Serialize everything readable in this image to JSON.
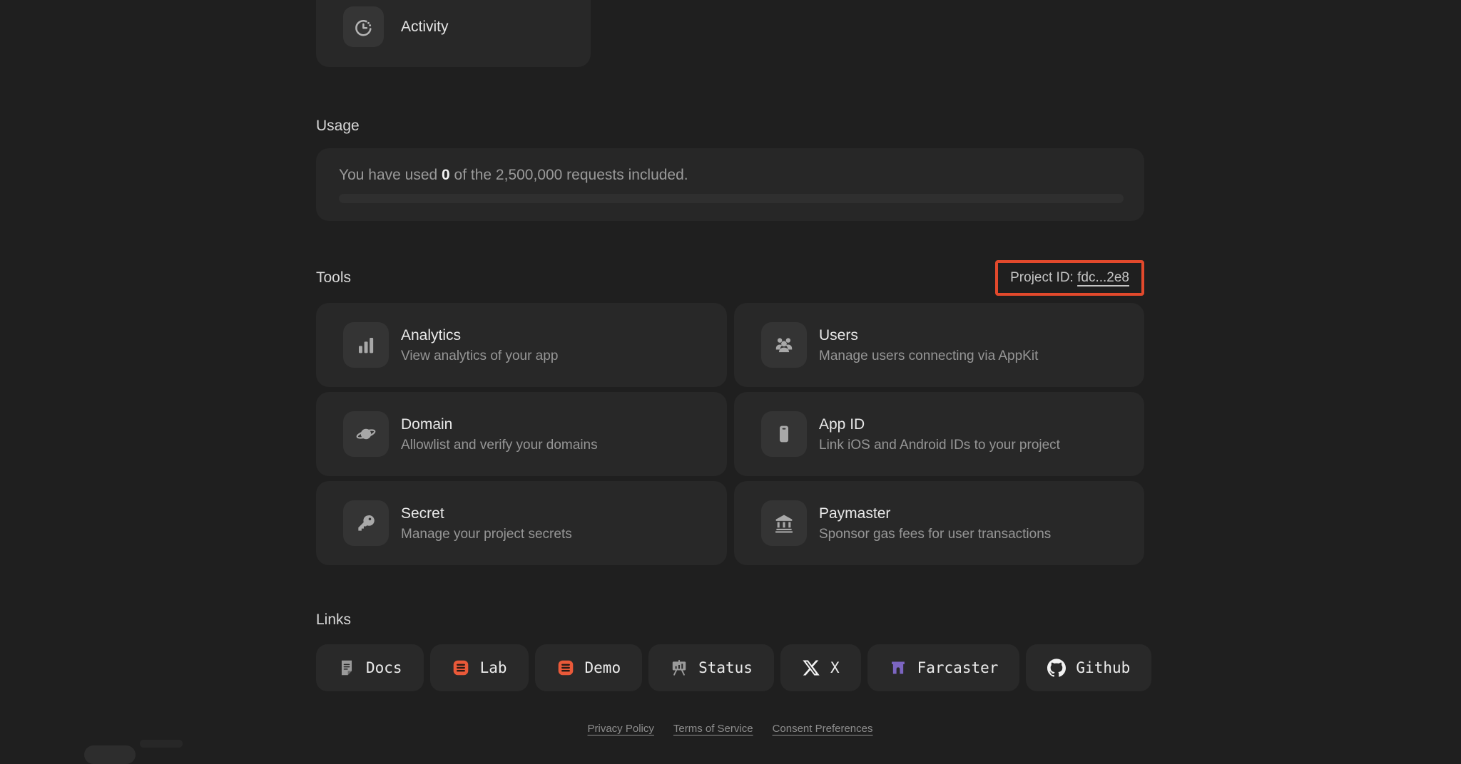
{
  "colors": {
    "page_bg": "#1F1F1F",
    "card_bg": "#282828",
    "tile_bg": "#343434",
    "button_bg": "#292929",
    "annotation_red": "#E2492C",
    "accent_orange": "#EA5939",
    "farcaster_purple": "#7C65C1"
  },
  "activity_card": {
    "label": "Activity",
    "icon": "clock-activity-icon"
  },
  "usage": {
    "heading": "Usage",
    "text_prefix": "You have used ",
    "used_value": "0",
    "text_suffix": " of the 2,500,000 requests included.",
    "progress_percent": 0
  },
  "tools": {
    "heading": "Tools",
    "project_id": {
      "label": "Project ID: ",
      "value": "fdc...2e8",
      "highlight_color": "#E2492C"
    },
    "cards": [
      {
        "title": "Analytics",
        "description": "View analytics of your app",
        "icon": "bar-chart-icon"
      },
      {
        "title": "Users",
        "description": "Manage users connecting via AppKit",
        "icon": "users-icon"
      },
      {
        "title": "Domain",
        "description": "Allowlist and verify your domains",
        "icon": "planet-icon"
      },
      {
        "title": "App ID",
        "description": "Link iOS and Android IDs to your project",
        "icon": "mobile-icon"
      },
      {
        "title": "Secret",
        "description": "Manage your project secrets",
        "icon": "key-icon"
      },
      {
        "title": "Paymaster",
        "description": "Sponsor gas fees for user transactions",
        "icon": "bank-icon"
      }
    ]
  },
  "links": {
    "heading": "Links",
    "items": [
      {
        "label": "Docs",
        "icon": "document-icon",
        "icon_color": "#9A9A9A"
      },
      {
        "label": "Lab",
        "icon": "lab-icon",
        "icon_color": "#EA5939"
      },
      {
        "label": "Demo",
        "icon": "demo-icon",
        "icon_color": "#EA5939"
      },
      {
        "label": "Status",
        "icon": "presentation-icon",
        "icon_color": "#9A9A9A"
      },
      {
        "label": "X",
        "icon": "x-logo-icon",
        "icon_color": "#F2F2F2"
      },
      {
        "label": "Farcaster",
        "icon": "farcaster-icon",
        "icon_color": "#7C65C1"
      },
      {
        "label": "Github",
        "icon": "github-icon",
        "icon_color": "#F2F2F2"
      }
    ]
  },
  "footer": {
    "links": [
      "Privacy Policy",
      "Terms of Service",
      "Consent Preferences"
    ]
  }
}
